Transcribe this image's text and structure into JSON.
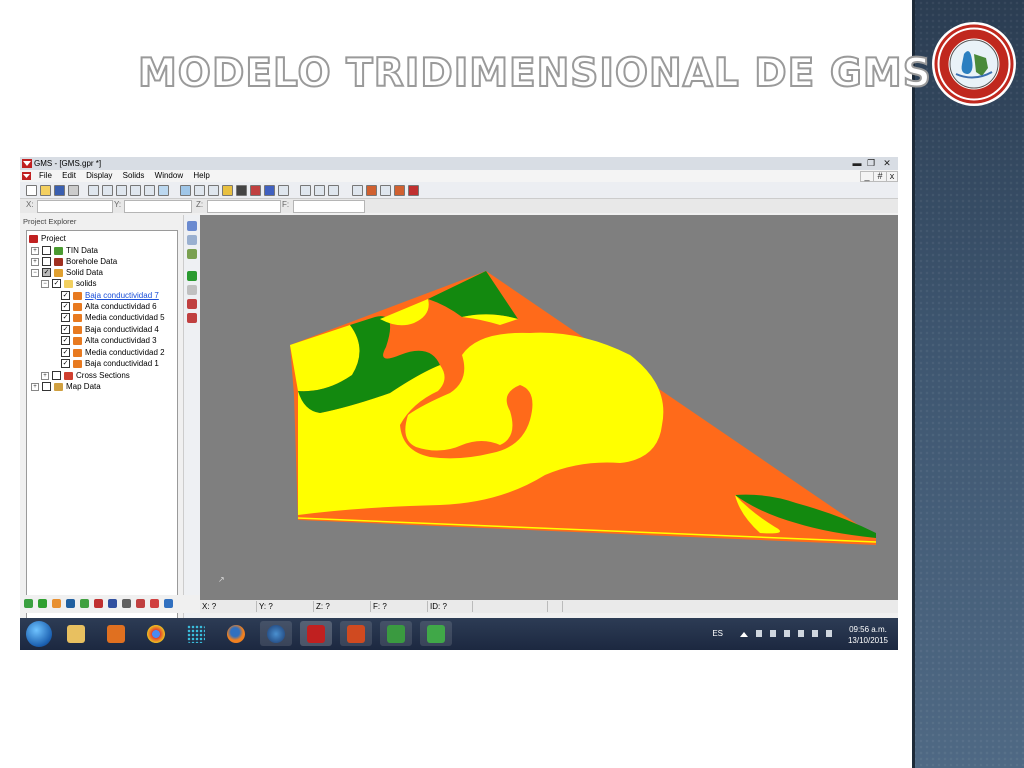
{
  "slide": {
    "title": "MODELO TRIDIMENSIONAL DE GMS"
  },
  "window": {
    "title": "GMS - [GMS.gpr *]",
    "controls": [
      "▬",
      "❐",
      "✕"
    ],
    "inner_controls": [
      "_",
      "#",
      "x"
    ]
  },
  "menu": [
    "File",
    "Edit",
    "Display",
    "Solids",
    "Window",
    "Help"
  ],
  "coords": {
    "x_label": "X:",
    "y_label": "Y:",
    "z_label": "Z:",
    "f_label": "F:"
  },
  "explorer": {
    "title": "Project Explorer",
    "project": "Project",
    "tin": "TIN Data",
    "borehole": "Borehole Data",
    "solid": "Solid Data",
    "solids": "solids",
    "items": [
      "Baja conductividad 7",
      "Alta conductividad 6",
      "Media conductividad 5",
      "Baja conductividad 4",
      "Alta conductividad 3",
      "Media conductividad 2",
      "Baja conductividad 1"
    ],
    "cross": "Cross Sections",
    "map": "Map Data"
  },
  "status": {
    "x": "X: ?",
    "y": "Y: ?",
    "z": "Z: ?",
    "f": "F: ?",
    "id": "ID: ?"
  },
  "taskbar": {
    "lang": "ES",
    "time": "09:56 a.m.",
    "date": "13/10/2015"
  },
  "colors": {
    "orange": "#ff6a1a",
    "yellow": "#ffff00",
    "green": "#13890f",
    "viewport": "#7f7f7f"
  }
}
